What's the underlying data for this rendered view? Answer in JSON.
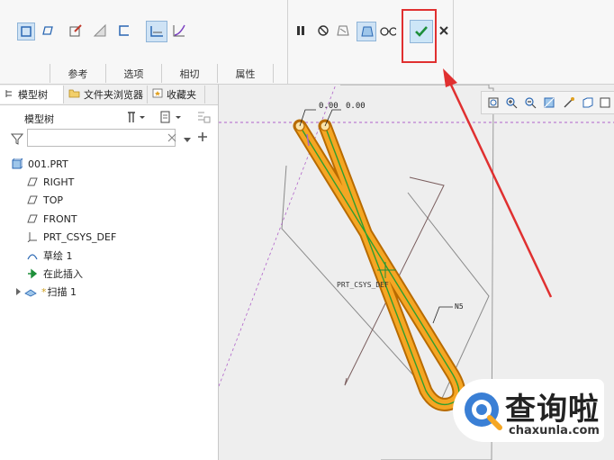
{
  "ribbon": {
    "tabs": [
      "参考",
      "选项",
      "相切",
      "属性"
    ],
    "tools_left": [
      "solid-icon",
      "surface-icon",
      "edit-icon",
      "remove-material-icon",
      "thicken-icon",
      "constant-section-icon",
      "variable-section-icon"
    ],
    "tools_right": [
      "pause-icon",
      "stop-icon",
      "preview-off-icon",
      "preview-on-icon",
      "verify-icon",
      "confirm-check-icon",
      "cancel-icon"
    ]
  },
  "panel": {
    "tabs": [
      "模型树",
      "文件夹浏览器",
      "收藏夹"
    ],
    "title": "模型树",
    "search_placeholder": "",
    "tree": [
      {
        "label": "001.PRT",
        "icon": "part-icon"
      },
      {
        "label": "RIGHT",
        "icon": "datum-plane-icon"
      },
      {
        "label": "TOP",
        "icon": "datum-plane-icon"
      },
      {
        "label": "FRONT",
        "icon": "datum-plane-icon"
      },
      {
        "label": "PRT_CSYS_DEF",
        "icon": "csys-icon"
      },
      {
        "label": "草绘 1",
        "icon": "sketch-icon"
      },
      {
        "label": "在此插入",
        "icon": "insert-arrow-icon"
      },
      {
        "label": "扫描 1",
        "icon": "sweep-icon"
      }
    ]
  },
  "viewport": {
    "dim1": "0.00",
    "dim2": "0.00",
    "csys_label": "PRT_CSYS_DEF",
    "trim_label": "N5"
  },
  "watermark": {
    "cn": "查询啦",
    "url": "chaxunla.com"
  },
  "colors": {
    "accent": "#3a7fd5",
    "confirm_bg": "#cde6f7",
    "highlight_red": "#e03030",
    "sweep_orange": "#f5a623",
    "sweep_edge": "#b86b00",
    "path_green": "#2f9e2f"
  }
}
